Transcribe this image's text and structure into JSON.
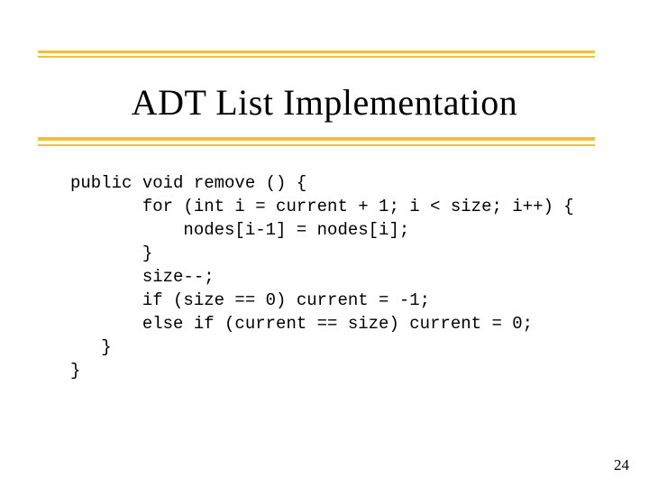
{
  "title": "ADT List Implementation",
  "code": {
    "l1": "public void remove () {",
    "l2": "       for (int i = current + 1; i < size; i++) {",
    "l3": "           nodes[i-1] = nodes[i];",
    "l4": "       }",
    "l5": "       size--;",
    "l6": "       if (size == 0) current = -1;",
    "l7": "       else if (current == size) current = 0;",
    "l8": "   }",
    "l9": "}"
  },
  "slide_number": "24"
}
